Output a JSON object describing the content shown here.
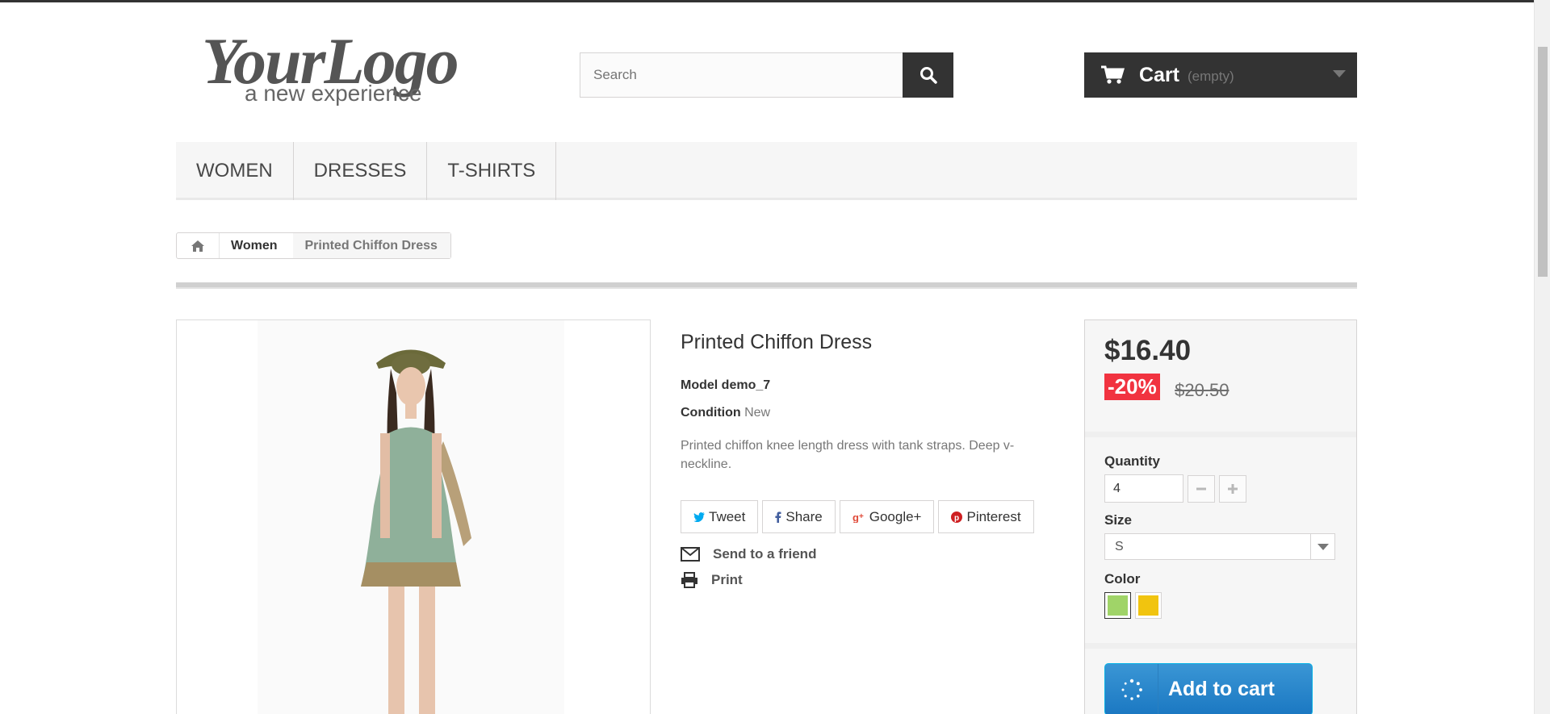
{
  "header": {
    "logo": {
      "script": "YourLogo",
      "tagline": "a new experience"
    },
    "search": {
      "placeholder": "Search",
      "value": ""
    },
    "cart": {
      "label": "Cart",
      "status": "(empty)"
    }
  },
  "menu": {
    "items": [
      {
        "label": "WOMEN"
      },
      {
        "label": "DRESSES"
      },
      {
        "label": "T-SHIRTS"
      }
    ]
  },
  "breadcrumb": {
    "items": [
      "Women",
      "Printed Chiffon Dress"
    ]
  },
  "product": {
    "title": "Printed Chiffon Dress",
    "model_label": "Model",
    "model_value": "demo_7",
    "condition_label": "Condition",
    "condition_value": "New",
    "description": "Printed chiffon knee length dress with tank straps. Deep v-neckline.",
    "share": [
      "Tweet",
      "Share",
      "Google+",
      "Pinterest"
    ],
    "actions": {
      "send_friend": "Send to a friend",
      "print": "Print"
    }
  },
  "buy_box": {
    "price": "$16.40",
    "reduction": "-20%",
    "old_price": "$20.50",
    "quantity_label": "Quantity",
    "quantity_value": "4",
    "size_label": "Size",
    "size_value": "S",
    "color_label": "Color",
    "colors": [
      {
        "name": "green",
        "hex": "#a0d468",
        "selected": true
      },
      {
        "name": "yellow",
        "hex": "#f1c40f",
        "selected": false
      }
    ],
    "add_to_cart": "Add to cart"
  },
  "colors": {
    "dark": "#333333",
    "sale_red": "#f13340",
    "cart_blue": "#2a8acd"
  }
}
